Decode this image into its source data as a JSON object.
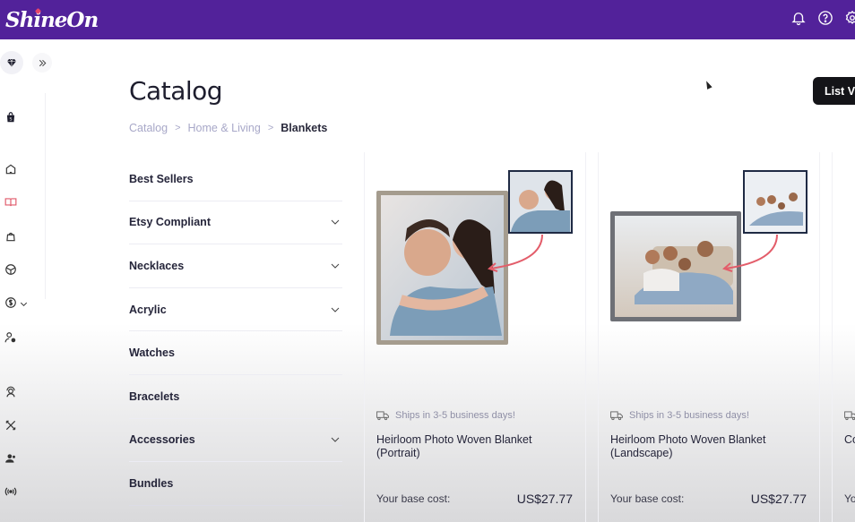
{
  "header": {
    "logo": "ShineOn",
    "icons": [
      "bell-icon",
      "help-icon",
      "settings-icon"
    ],
    "brand_color": "#52229a"
  },
  "sidebar": {
    "icons": [
      "gem-icon",
      "expand-icon",
      "shopify-bag-icon",
      "home-icon",
      "catalog-book-icon",
      "bag-icon",
      "box-icon",
      "dollar-icon",
      "user-settings-icon",
      "support-agent-icon",
      "tools-icon",
      "team-icon",
      "broadcast-icon"
    ],
    "active_color": "#e05a6b"
  },
  "main": {
    "title": "Catalog",
    "breadcrumb": [
      "Catalog",
      "Home & Living",
      "Blankets"
    ],
    "list_view_label": "List Vi"
  },
  "categories": [
    {
      "label": "Best Sellers",
      "expandable": false
    },
    {
      "label": "Etsy Compliant",
      "expandable": true
    },
    {
      "label": "Necklaces",
      "expandable": true
    },
    {
      "label": "Acrylic",
      "expandable": true
    },
    {
      "label": "Watches",
      "expandable": false
    },
    {
      "label": "Bracelets",
      "expandable": false
    },
    {
      "label": "Accessories",
      "expandable": true
    },
    {
      "label": "Bundles",
      "expandable": false
    }
  ],
  "products": [
    {
      "shipping": "Ships in 3-5 business days!",
      "title": "Heirloom Photo Woven Blanket\n(Portrait)",
      "cost_label": "Your base cost:",
      "cost": "US$27.77"
    },
    {
      "shipping": "Ships in 3-5 business days!",
      "title": "Heirloom Photo Woven Blanket\n(Landscape)",
      "cost_label": "Your base cost:",
      "cost": "US$27.77"
    },
    {
      "shipping": "",
      "title": "Co",
      "cost_label": "Yo",
      "cost": ""
    }
  ]
}
